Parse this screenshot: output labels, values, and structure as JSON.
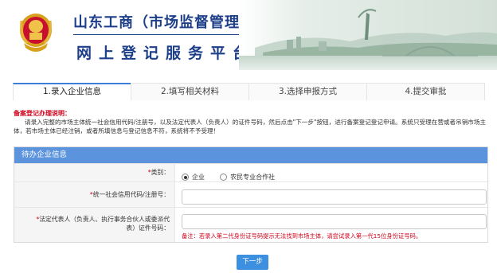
{
  "header": {
    "title_line1": "山东工商（市场监督管理）",
    "title_line2": "网上登记服务平台"
  },
  "tabs": [
    {
      "label": "1.录入企业信息",
      "active": true
    },
    {
      "label": "2.填写相关材料",
      "active": false
    },
    {
      "label": "3.选择申报方式",
      "active": false
    },
    {
      "label": "4.提交审批",
      "active": false
    }
  ],
  "notice": {
    "title": "备案登记办理说明：",
    "body": "请录入完整的市场主体统一社会信用代码/注册号，以及法定代表人（负责人）的证件号码，然后点击\"下一步\"按钮，进行备案登记登记申请。系统只受理在营或者吊销市场主体，若市场主体已经注销，或者所填信息与登记信息不符，系统将不予受理！"
  },
  "form": {
    "header": "待办企业信息",
    "type_label": "类别：",
    "type_options": [
      "企业",
      "农民专业合作社"
    ],
    "type_selected": "企业",
    "code_label": "统一社会信用代码/注册号：",
    "code_value": "",
    "rep_label_line1": "法定代表人（负责人、执行事务合伙人或委派代",
    "rep_label_line2": "表）证件号码：",
    "rep_value": "",
    "rep_hint": "备注：若录入第二代身份证号码提示无法找到市场主体，请尝试录入第一代15位身份证号码。"
  },
  "buttons": {
    "next": "下一步"
  },
  "colors": {
    "brand_blue": "#1d3f8a",
    "panel_header": "#5b93dc",
    "button": "#3d8fe0",
    "required_red": "#d0021b"
  },
  "icons": {
    "emblem": "national-emblem-icon",
    "scenery": "city-scenery-banner"
  }
}
